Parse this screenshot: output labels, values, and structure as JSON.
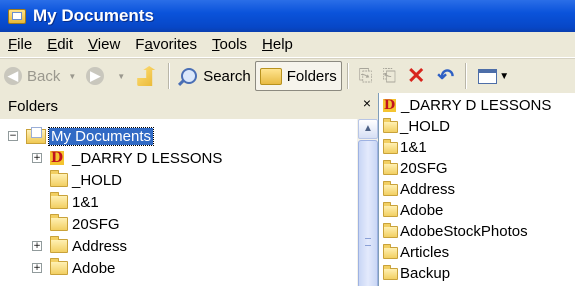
{
  "window": {
    "title": "My Documents"
  },
  "menu": [
    {
      "label": "File",
      "key": "F",
      "rest": "ile"
    },
    {
      "label": "Edit",
      "key": "E",
      "rest": "dit"
    },
    {
      "label": "View",
      "key": "V",
      "rest": "iew"
    },
    {
      "label": "Favorites",
      "key": "a",
      "pre": "F",
      "rest": "vorites"
    },
    {
      "label": "Tools",
      "key": "T",
      "rest": "ools"
    },
    {
      "label": "Help",
      "key": "H",
      "rest": "elp"
    }
  ],
  "toolbar": {
    "back_label": "Back",
    "search_label": "Search",
    "folders_label": "Folders"
  },
  "folders_pane": {
    "header": "Folders",
    "close_glyph": "×",
    "tree": [
      {
        "label": "My Documents",
        "expander": "−",
        "icon": "my-documents-icon",
        "selected": true
      },
      {
        "label": "_DARRY D LESSONS",
        "expander": "+",
        "icon": "darry-d-icon"
      },
      {
        "label": "_HOLD",
        "expander": "",
        "icon": "folder-icon"
      },
      {
        "label": "1&1",
        "expander": "",
        "icon": "folder-icon"
      },
      {
        "label": "20SFG",
        "expander": "",
        "icon": "folder-icon"
      },
      {
        "label": "Address",
        "expander": "+",
        "icon": "folder-icon"
      },
      {
        "label": "Adobe",
        "expander": "+",
        "icon": "folder-icon"
      }
    ]
  },
  "contents": {
    "items": [
      {
        "label": "_DARRY D LESSONS",
        "icon": "darry-d-icon"
      },
      {
        "label": "_HOLD",
        "icon": "folder-icon"
      },
      {
        "label": "1&1",
        "icon": "folder-icon"
      },
      {
        "label": "20SFG",
        "icon": "folder-icon"
      },
      {
        "label": "Address",
        "icon": "folder-icon"
      },
      {
        "label": "Adobe",
        "icon": "folder-icon"
      },
      {
        "label": "AdobeStockPhotos",
        "icon": "folder-icon"
      },
      {
        "label": "Articles",
        "icon": "folder-icon"
      },
      {
        "label": "Backup",
        "icon": "folder-icon"
      }
    ]
  },
  "colors": {
    "titlebar": "#0a53db",
    "selection": "#316ac5",
    "chrome": "#ece9d8",
    "delete_red": "#d8241c"
  }
}
